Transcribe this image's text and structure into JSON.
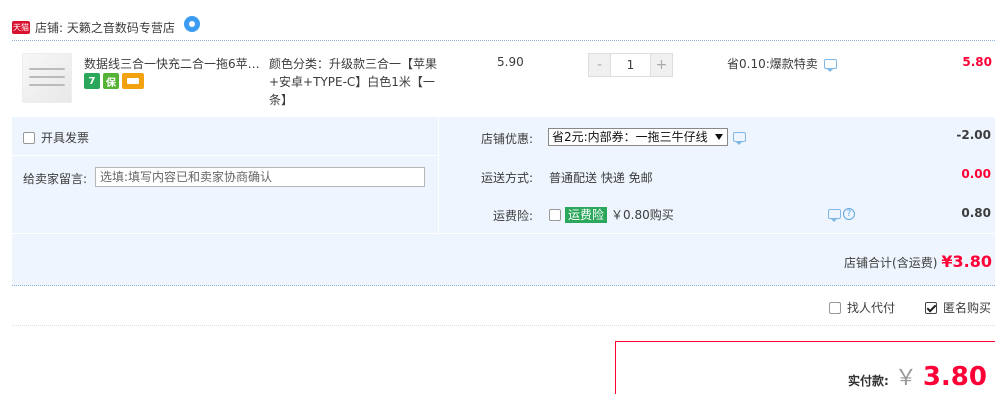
{
  "shop": {
    "badge": "天猫",
    "name": "店铺: 天籁之音数码专营店"
  },
  "item": {
    "title": "数据线三合一快充二合一拖6苹…",
    "badges": [
      "7",
      "保",
      ""
    ],
    "sku": "颜色分类：升级款三合一【苹果+安卓+TYPE-C】白色1米【一条】",
    "price": "5.90",
    "quantity": "1",
    "qty_minus": "-",
    "qty_plus": "+",
    "promo": "省0.10:爆款特卖",
    "subtotal": "5.80"
  },
  "invoice": {
    "label": "开具发票",
    "checked": false
  },
  "message": {
    "label": "给卖家留言:",
    "placeholder": "选填:填写内容已和卖家协商确认"
  },
  "discount": {
    "label": "店铺优惠:",
    "selected": "省2元:内部券：一拖三牛仔线",
    "amount": "-2.00"
  },
  "shipping": {
    "label": "运送方式:",
    "value": "普通配送 快递 免邮",
    "amount": "0.00"
  },
  "insurance": {
    "label": "运费险:",
    "tag": "运费险",
    "text": "￥0.80购买",
    "amount": "0.80",
    "help": "?"
  },
  "shop_total": {
    "label": "店铺合计(含运费)",
    "value": "¥3.80"
  },
  "options": {
    "proxy_pay": "找人代付",
    "anonymous": "匿名购买",
    "proxy_checked": false,
    "anonymous_checked": true
  },
  "payment": {
    "label": "实付款:",
    "currency": "￥",
    "value": "3.80"
  },
  "colors": {
    "accent": "#ff0036",
    "area_bg": "#eef5fe",
    "tag_green": "#2aa75b"
  }
}
